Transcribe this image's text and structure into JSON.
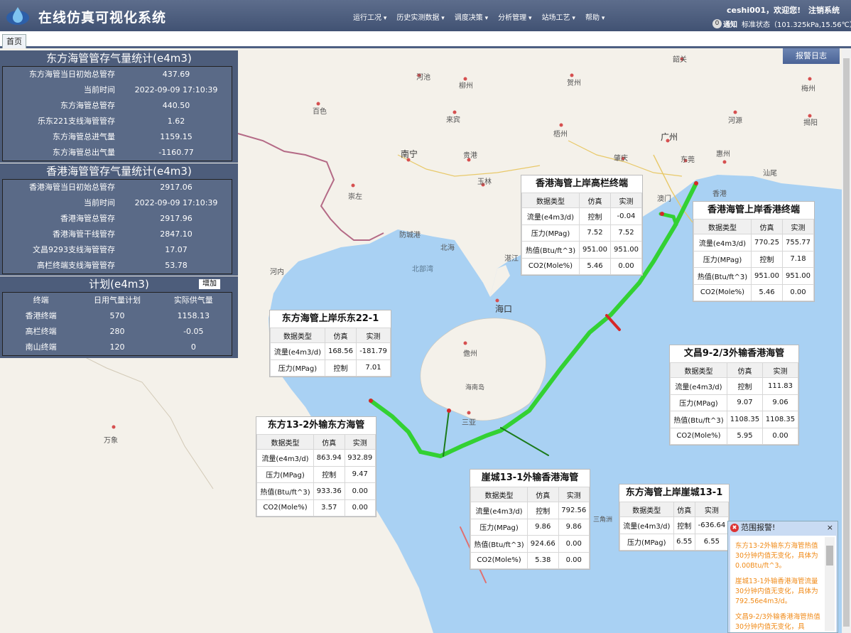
{
  "header": {
    "title": "在线仿真可视化系统",
    "menu": [
      "运行工况",
      "历史实测数据",
      "调度决策",
      "分析管理",
      "站场工艺",
      "帮助"
    ],
    "user": "ceshi001，欢迎您!",
    "logout": "注销系统",
    "notice_count": "0",
    "notice_label": "通知",
    "status": "标准状态（101.325kPa,15.56℃）"
  },
  "tabs": [
    "首页"
  ],
  "alarm_log_button": "报警日志",
  "panel_dongfang": {
    "title": "东方海管管存气量统计(e4m3)",
    "rows": [
      {
        "label": "东方海管当日初始总管存",
        "value": "437.69"
      },
      {
        "label": "当前时间",
        "value": "2022-09-09 17:10:39"
      },
      {
        "label": "东方海管总管存",
        "value": "440.50"
      },
      {
        "label": "乐东221支线海管管存",
        "value": "1.62"
      },
      {
        "label": "东方海管总进气量",
        "value": "1159.15"
      },
      {
        "label": "东方海管总出气量",
        "value": "-1160.77"
      }
    ]
  },
  "panel_hongkong": {
    "title": "香港海管管存气量统计(e4m3)",
    "rows": [
      {
        "label": "香港海管当日初始总管存",
        "value": "2917.06"
      },
      {
        "label": "当前时间",
        "value": "2022-09-09 17:10:39"
      },
      {
        "label": "香港海管总管存",
        "value": "2917.96"
      },
      {
        "label": "香港海管干线管存",
        "value": "2847.10"
      },
      {
        "label": "文昌9293支线海管管存",
        "value": "17.07"
      },
      {
        "label": "高栏终端支线海管管存",
        "value": "53.78"
      }
    ]
  },
  "panel_plan": {
    "title": "计划(e4m3)",
    "add_button": "增加",
    "headers": [
      "终端",
      "日用气量计划",
      "实际供气量"
    ],
    "rows": [
      [
        "香港终端",
        "570",
        "1158.13"
      ],
      [
        "高栏终端",
        "280",
        "-0.05"
      ],
      [
        "南山终端",
        "120",
        "0"
      ]
    ]
  },
  "tables": {
    "gaolan": {
      "title": "香港海管上岸高栏终端",
      "headers": [
        "数据类型",
        "仿真",
        "实测"
      ],
      "rows": [
        [
          "流量(e4m3/d)",
          "控制",
          "-0.04"
        ],
        [
          "压力(MPag)",
          "7.52",
          "7.52"
        ],
        [
          "热值(Btu/ft^3)",
          "951.00",
          "951.00"
        ],
        [
          "CO2(Mole%)",
          "5.46",
          "0.00"
        ]
      ]
    },
    "hongkong": {
      "title": "香港海管上岸香港终端",
      "headers": [
        "数据类型",
        "仿真",
        "实测"
      ],
      "rows": [
        [
          "流量(e4m3/d)",
          "770.25",
          "755.77"
        ],
        [
          "压力(MPag)",
          "控制",
          "7.18"
        ],
        [
          "热值(Btu/ft^3)",
          "951.00",
          "951.00"
        ],
        [
          "CO2(Mole%)",
          "5.46",
          "0.00"
        ]
      ]
    },
    "ledong": {
      "title": "东方海管上岸乐东22-1",
      "headers": [
        "数据类型",
        "仿真",
        "实测"
      ],
      "rows": [
        [
          "流量(e4m3/d)",
          "168.56",
          "-181.79"
        ],
        [
          "压力(MPag)",
          "控制",
          "7.01"
        ]
      ]
    },
    "wenchang": {
      "title": "文昌9-2/3外输香港海管",
      "headers": [
        "数据类型",
        "仿真",
        "实测"
      ],
      "rows": [
        [
          "流量(e4m3/d)",
          "控制",
          "111.83"
        ],
        [
          "压力(MPag)",
          "9.07",
          "9.06"
        ],
        [
          "热值(Btu/ft^3)",
          "1108.35",
          "1108.35"
        ],
        [
          "CO2(Mole%)",
          "5.95",
          "0.00"
        ]
      ]
    },
    "dongfang132": {
      "title": "东方13-2外输东方海管",
      "headers": [
        "数据类型",
        "仿真",
        "实测"
      ],
      "rows": [
        [
          "流量(e4m3/d)",
          "863.94",
          "932.89"
        ],
        [
          "压力(MPag)",
          "控制",
          "9.47"
        ],
        [
          "热值(Btu/ft^3)",
          "933.36",
          "0.00"
        ],
        [
          "CO2(Mole%)",
          "3.57",
          "0.00"
        ]
      ]
    },
    "yacheng": {
      "title": "崖城13-1外输香港海管",
      "headers": [
        "数据类型",
        "仿真",
        "实测"
      ],
      "rows": [
        [
          "流量(e4m3/d)",
          "控制",
          "792.56"
        ],
        [
          "压力(MPag)",
          "9.86",
          "9.86"
        ],
        [
          "热值(Btu/ft^3)",
          "924.66",
          "0.00"
        ],
        [
          "CO2(Mole%)",
          "5.38",
          "0.00"
        ]
      ]
    },
    "yachengshore": {
      "title": "东方海管上岸崖城13-1",
      "headers": [
        "数据类型",
        "仿真",
        "实测"
      ],
      "rows": [
        [
          "流量(e4m3/d)",
          "控制",
          "-636.64"
        ],
        [
          "压力(MPag)",
          "6.55",
          "6.55"
        ]
      ]
    }
  },
  "alert": {
    "title": "范围报警!",
    "close": "×",
    "messages": [
      "东方13-2外输东方海管热值30分钟内值无变化，具体为0.00Btu/ft^3。",
      "崖城13-1外输香港海管流量30分钟内值无变化，具体为792.56e4m3/d。",
      "文昌9-2/3外输香港海管热值30分钟内值无变化，具"
    ]
  },
  "map_labels": [
    "河池",
    "柳州",
    "贺州",
    "韶关",
    "梅州",
    "百色",
    "来宾",
    "梧州",
    "河源",
    "揭阳",
    "广州",
    "南宁",
    "贵港",
    "肇庆",
    "东莞",
    "惠州",
    "汕尾",
    "崇左",
    "玉林",
    "澳门",
    "香港",
    "防城港",
    "北海",
    "湛江",
    "河内",
    "北部湾",
    "海口",
    "儋州",
    "海南岛",
    "三亚",
    "万象",
    "三角洲"
  ],
  "colors": {
    "header": "#4d5f82",
    "pipe": "#33d133",
    "pipe_dark": "#1b7a1b",
    "alert_text": "#f08a17"
  }
}
